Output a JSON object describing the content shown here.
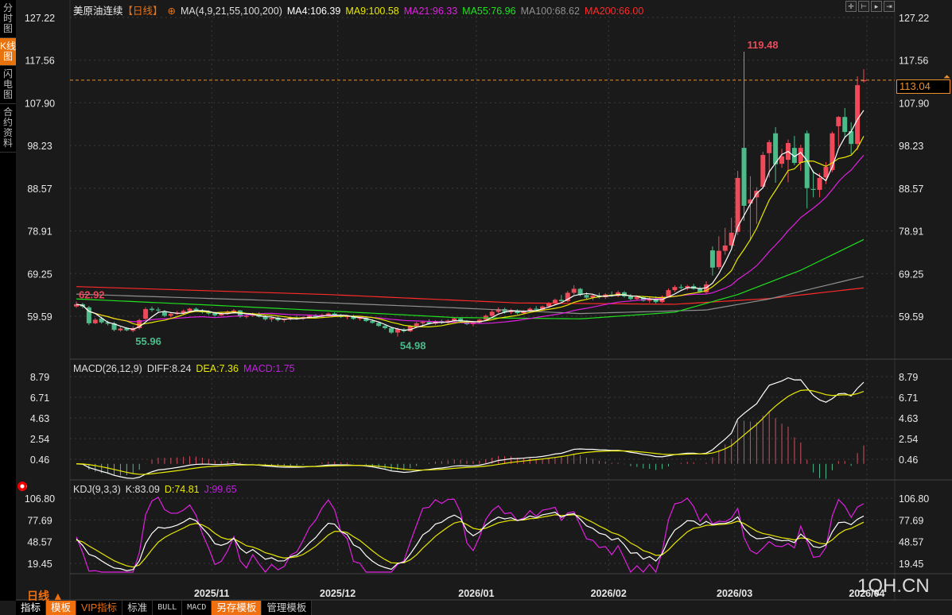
{
  "sidebar": {
    "tabs": [
      {
        "label": "分时图",
        "active": false
      },
      {
        "label": "K线图",
        "active": true
      },
      {
        "label": "闪电图",
        "active": false
      },
      {
        "label": "合约资料",
        "active": false
      }
    ]
  },
  "header": {
    "instrument": "美原油连续",
    "period": "【日线】",
    "ma_label": "MA(4,9,21,55,100,200)",
    "ma4": "MA4:106.39",
    "ma9": "MA9:100.58",
    "ma21": "MA21:96.33",
    "ma55": "MA55:76.96",
    "ma100": "MA100:68.62",
    "ma200": "MA200:66.00"
  },
  "toolbar_icons": [
    "crosshair-icon",
    "zoom-in-icon",
    "zoom-out-icon",
    "move-right-icon"
  ],
  "current_price": "113.04",
  "macd_header": {
    "name": "MACD(26,12,9)",
    "diff": "DIFF:8.24",
    "dea": "DEA:7.36",
    "macd": "MACD:1.75"
  },
  "kdj_header": {
    "name": "KDJ(9,3,3)",
    "k": "K:83.09",
    "d": "D:74.81",
    "j": "J:99.65"
  },
  "period_button": "日线 ▲",
  "bottom_tabs": [
    "指标",
    "模板",
    "VIP指标",
    "标准",
    "BULL",
    "MACD",
    "另存模板",
    "管理模板"
  ],
  "watermark": "1QH.CN",
  "colors": {
    "up": "#ee4a5a",
    "down": "#4cbb8a",
    "ma4": "#ffffff",
    "ma9": "#e8e800",
    "ma21": "#e020e0",
    "ma55": "#20e020",
    "ma100": "#909090",
    "ma200": "#ff2a2a",
    "price_line": "#e8902c"
  },
  "chart_data": {
    "type": "candlestick",
    "price_axis_ticks": [
      "127.22",
      "117.56",
      "107.90",
      "98.23",
      "88.57",
      "78.91",
      "69.25",
      "59.59"
    ],
    "macd_axis_ticks": [
      "8.79",
      "6.71",
      "4.63",
      "2.54",
      "0.46"
    ],
    "kdj_axis_ticks": [
      "106.80",
      "77.69",
      "48.57",
      "19.45"
    ],
    "date_labels": [
      {
        "label": "2025/11",
        "index": 22
      },
      {
        "label": "2025/12",
        "index": 42
      },
      {
        "label": "2026/01",
        "index": 64
      },
      {
        "label": "2026/02",
        "index": 85
      },
      {
        "label": "2026/03",
        "index": 105
      },
      {
        "label": "2026/04",
        "index": 126
      }
    ],
    "annotations": [
      {
        "label": "62.92",
        "index": 0,
        "kind": "high"
      },
      {
        "label": "55.96",
        "index": 9,
        "kind": "low"
      },
      {
        "label": "54.98",
        "index": 51,
        "kind": "low"
      },
      {
        "label": "119.48",
        "index": 106,
        "kind": "high"
      }
    ],
    "ohlc": [
      [
        61.8,
        62.92,
        61.5,
        62.3
      ],
      [
        62.3,
        62.6,
        61.4,
        61.8
      ],
      [
        61.6,
        61.9,
        57.6,
        58.0
      ],
      [
        58.0,
        59.2,
        57.8,
        58.8
      ],
      [
        59.1,
        59.5,
        57.9,
        58.2
      ],
      [
        58.2,
        58.6,
        57.5,
        57.9
      ],
      [
        58.0,
        58.3,
        56.2,
        56.5
      ],
      [
        56.4,
        57.2,
        56.1,
        56.8
      ],
      [
        56.9,
        57.1,
        56.2,
        56.4
      ],
      [
        56.3,
        57.3,
        55.96,
        56.9
      ],
      [
        56.9,
        59.0,
        56.6,
        58.7
      ],
      [
        59.0,
        61.6,
        58.8,
        61.2
      ],
      [
        61.3,
        61.8,
        60.6,
        61.0
      ],
      [
        61.1,
        61.6,
        60.5,
        60.9
      ],
      [
        60.6,
        61.0,
        59.4,
        59.7
      ],
      [
        59.7,
        60.5,
        59.3,
        60.1
      ],
      [
        60.1,
        60.8,
        59.8,
        60.4
      ],
      [
        60.3,
        61.1,
        60.0,
        60.8
      ],
      [
        60.8,
        61.5,
        60.5,
        61.3
      ],
      [
        61.3,
        61.6,
        60.6,
        60.9
      ],
      [
        60.9,
        61.2,
        60.2,
        60.5
      ],
      [
        60.5,
        60.9,
        59.9,
        60.2
      ],
      [
        60.3,
        60.6,
        59.5,
        59.8
      ],
      [
        59.8,
        60.5,
        59.6,
        60.2
      ],
      [
        60.2,
        60.9,
        59.9,
        60.6
      ],
      [
        60.5,
        61.2,
        60.2,
        60.9
      ],
      [
        60.9,
        61.0,
        59.2,
        59.5
      ],
      [
        59.5,
        60.0,
        59.1,
        59.6
      ],
      [
        59.7,
        60.4,
        59.4,
        60.1
      ],
      [
        60.2,
        60.5,
        59.3,
        59.5
      ],
      [
        59.5,
        59.8,
        58.6,
        58.9
      ],
      [
        58.9,
        59.4,
        58.3,
        59.2
      ],
      [
        59.3,
        59.6,
        58.4,
        58.7
      ],
      [
        58.7,
        59.1,
        58.2,
        58.9
      ],
      [
        58.9,
        59.5,
        58.6,
        59.3
      ],
      [
        59.3,
        59.7,
        58.8,
        59.0
      ],
      [
        59.0,
        59.6,
        58.7,
        59.4
      ],
      [
        59.4,
        59.9,
        59.1,
        59.7
      ],
      [
        59.7,
        60.1,
        59.3,
        59.5
      ],
      [
        59.5,
        60.2,
        59.2,
        59.9
      ],
      [
        59.9,
        60.4,
        59.6,
        60.2
      ],
      [
        60.2,
        60.5,
        59.6,
        59.8
      ],
      [
        59.8,
        60.1,
        59.2,
        59.4
      ],
      [
        59.4,
        59.8,
        58.9,
        59.6
      ],
      [
        59.6,
        59.9,
        58.8,
        59.0
      ],
      [
        59.0,
        59.5,
        58.6,
        59.2
      ],
      [
        59.2,
        59.4,
        58.3,
        58.5
      ],
      [
        58.5,
        58.9,
        57.9,
        58.1
      ],
      [
        58.1,
        58.4,
        57.2,
        57.4
      ],
      [
        57.4,
        57.7,
        56.6,
        56.9
      ],
      [
        56.9,
        57.2,
        55.6,
        55.9
      ],
      [
        55.9,
        57.0,
        54.98,
        56.7
      ],
      [
        56.6,
        56.9,
        55.9,
        56.2
      ],
      [
        56.2,
        57.6,
        56.0,
        57.4
      ],
      [
        57.4,
        58.3,
        57.1,
        58.0
      ],
      [
        58.0,
        58.6,
        57.6,
        58.3
      ],
      [
        58.3,
        58.9,
        57.7,
        57.9
      ],
      [
        57.9,
        58.7,
        57.6,
        58.5
      ],
      [
        58.5,
        58.8,
        57.8,
        58.1
      ],
      [
        58.1,
        58.9,
        57.9,
        58.6
      ],
      [
        58.6,
        59.4,
        58.3,
        59.1
      ],
      [
        59.1,
        59.3,
        58.2,
        58.4
      ],
      [
        58.4,
        58.7,
        57.6,
        57.8
      ],
      [
        57.8,
        58.4,
        57.3,
        58.2
      ],
      [
        58.2,
        59.0,
        57.9,
        58.8
      ],
      [
        58.8,
        60.0,
        58.5,
        59.7
      ],
      [
        59.7,
        61.0,
        59.5,
        60.6
      ],
      [
        60.6,
        61.6,
        60.3,
        61.2
      ],
      [
        61.2,
        61.5,
        60.2,
        60.5
      ],
      [
        60.5,
        61.3,
        60.1,
        60.9
      ],
      [
        60.9,
        61.2,
        60.0,
        60.3
      ],
      [
        60.3,
        61.0,
        60.0,
        60.8
      ],
      [
        60.8,
        61.6,
        60.5,
        61.3
      ],
      [
        61.3,
        61.9,
        60.8,
        61.1
      ],
      [
        61.1,
        62.0,
        60.9,
        61.8
      ],
      [
        61.8,
        62.8,
        61.5,
        62.5
      ],
      [
        62.5,
        63.6,
        62.1,
        63.3
      ],
      [
        63.3,
        64.4,
        62.9,
        63.0
      ],
      [
        63.0,
        65.3,
        62.8,
        64.9
      ],
      [
        64.9,
        66.6,
        64.5,
        65.8
      ],
      [
        65.8,
        66.0,
        64.1,
        64.4
      ],
      [
        64.4,
        65.0,
        63.4,
        63.8
      ],
      [
        63.8,
        64.6,
        63.2,
        64.3
      ],
      [
        64.3,
        64.9,
        63.6,
        63.9
      ],
      [
        63.9,
        64.8,
        63.5,
        64.5
      ],
      [
        64.5,
        65.2,
        64.0,
        64.2
      ],
      [
        64.2,
        65.4,
        63.9,
        65.0
      ],
      [
        65.0,
        65.3,
        63.8,
        64.1
      ],
      [
        64.1,
        64.6,
        63.2,
        63.5
      ],
      [
        63.5,
        64.3,
        63.1,
        63.9
      ],
      [
        63.9,
        64.2,
        62.9,
        63.1
      ],
      [
        63.1,
        63.9,
        62.6,
        63.6
      ],
      [
        63.6,
        64.1,
        62.5,
        62.8
      ],
      [
        62.8,
        64.3,
        62.6,
        64.0
      ],
      [
        64.0,
        65.9,
        63.8,
        65.5
      ],
      [
        65.5,
        66.6,
        65.1,
        66.2
      ],
      [
        66.2,
        66.8,
        65.7,
        66.0
      ],
      [
        66.0,
        66.7,
        65.5,
        66.4
      ],
      [
        66.4,
        66.9,
        65.6,
        65.8
      ],
      [
        65.8,
        66.3,
        64.9,
        65.1
      ],
      [
        65.0,
        67.5,
        64.6,
        66.8
      ],
      [
        74.5,
        75.4,
        68.8,
        70.6
      ],
      [
        70.7,
        77.7,
        70.2,
        74.4
      ],
      [
        74.4,
        79.6,
        73.5,
        75.6
      ],
      [
        75.6,
        81.9,
        75.2,
        78.5
      ],
      [
        78.7,
        92.5,
        78.0,
        90.9
      ],
      [
        97.7,
        119.48,
        81.2,
        84.6
      ],
      [
        85.1,
        91.3,
        76.7,
        86.0
      ],
      [
        86.5,
        88.8,
        80.5,
        88.0
      ],
      [
        88.9,
        96.8,
        88.5,
        96.1
      ],
      [
        96.5,
        99.5,
        91.0,
        99.0
      ],
      [
        101.0,
        102.4,
        89.8,
        94.0
      ],
      [
        94.1,
        97.5,
        93.2,
        95.8
      ],
      [
        95.0,
        99.6,
        89.9,
        98.8
      ],
      [
        97.7,
        100.4,
        93.8,
        94.3
      ],
      [
        94.3,
        98.4,
        92.5,
        97.7
      ],
      [
        101.0,
        101.6,
        84.0,
        88.6
      ],
      [
        88.4,
        92.6,
        86.5,
        88.2
      ],
      [
        88.2,
        92.0,
        86.5,
        90.9
      ],
      [
        91.0,
        94.5,
        89.5,
        93.4
      ],
      [
        92.7,
        101.4,
        92.2,
        101.0
      ],
      [
        102.6,
        104.9,
        98.0,
        104.7
      ],
      [
        104.7,
        106.7,
        100.0,
        101.3
      ],
      [
        101.5,
        103.5,
        96.3,
        98.6
      ],
      [
        98.6,
        113.9,
        97.2,
        111.9
      ],
      [
        112.8,
        115.5,
        112.5,
        113.04
      ]
    ],
    "ma_anchors": {
      "ma55": [
        [
          0,
          63.5
        ],
        [
          20,
          62.2
        ],
        [
          40,
          60.8
        ],
        [
          60,
          59.3
        ],
        [
          80,
          59.0
        ],
        [
          95,
          60.5
        ],
        [
          105,
          64.5
        ],
        [
          115,
          70
        ],
        [
          125,
          76.96
        ]
      ],
      "ma100": [
        [
          0,
          64.6
        ],
        [
          30,
          63.2
        ],
        [
          60,
          61.5
        ],
        [
          80,
          60.2
        ],
        [
          100,
          61.0
        ],
        [
          110,
          63.5
        ],
        [
          125,
          68.62
        ]
      ],
      "ma200": [
        [
          0,
          66.3
        ],
        [
          40,
          64.5
        ],
        [
          70,
          62.6
        ],
        [
          95,
          62.3
        ],
        [
          110,
          63.6
        ],
        [
          125,
          66.0
        ]
      ]
    }
  }
}
